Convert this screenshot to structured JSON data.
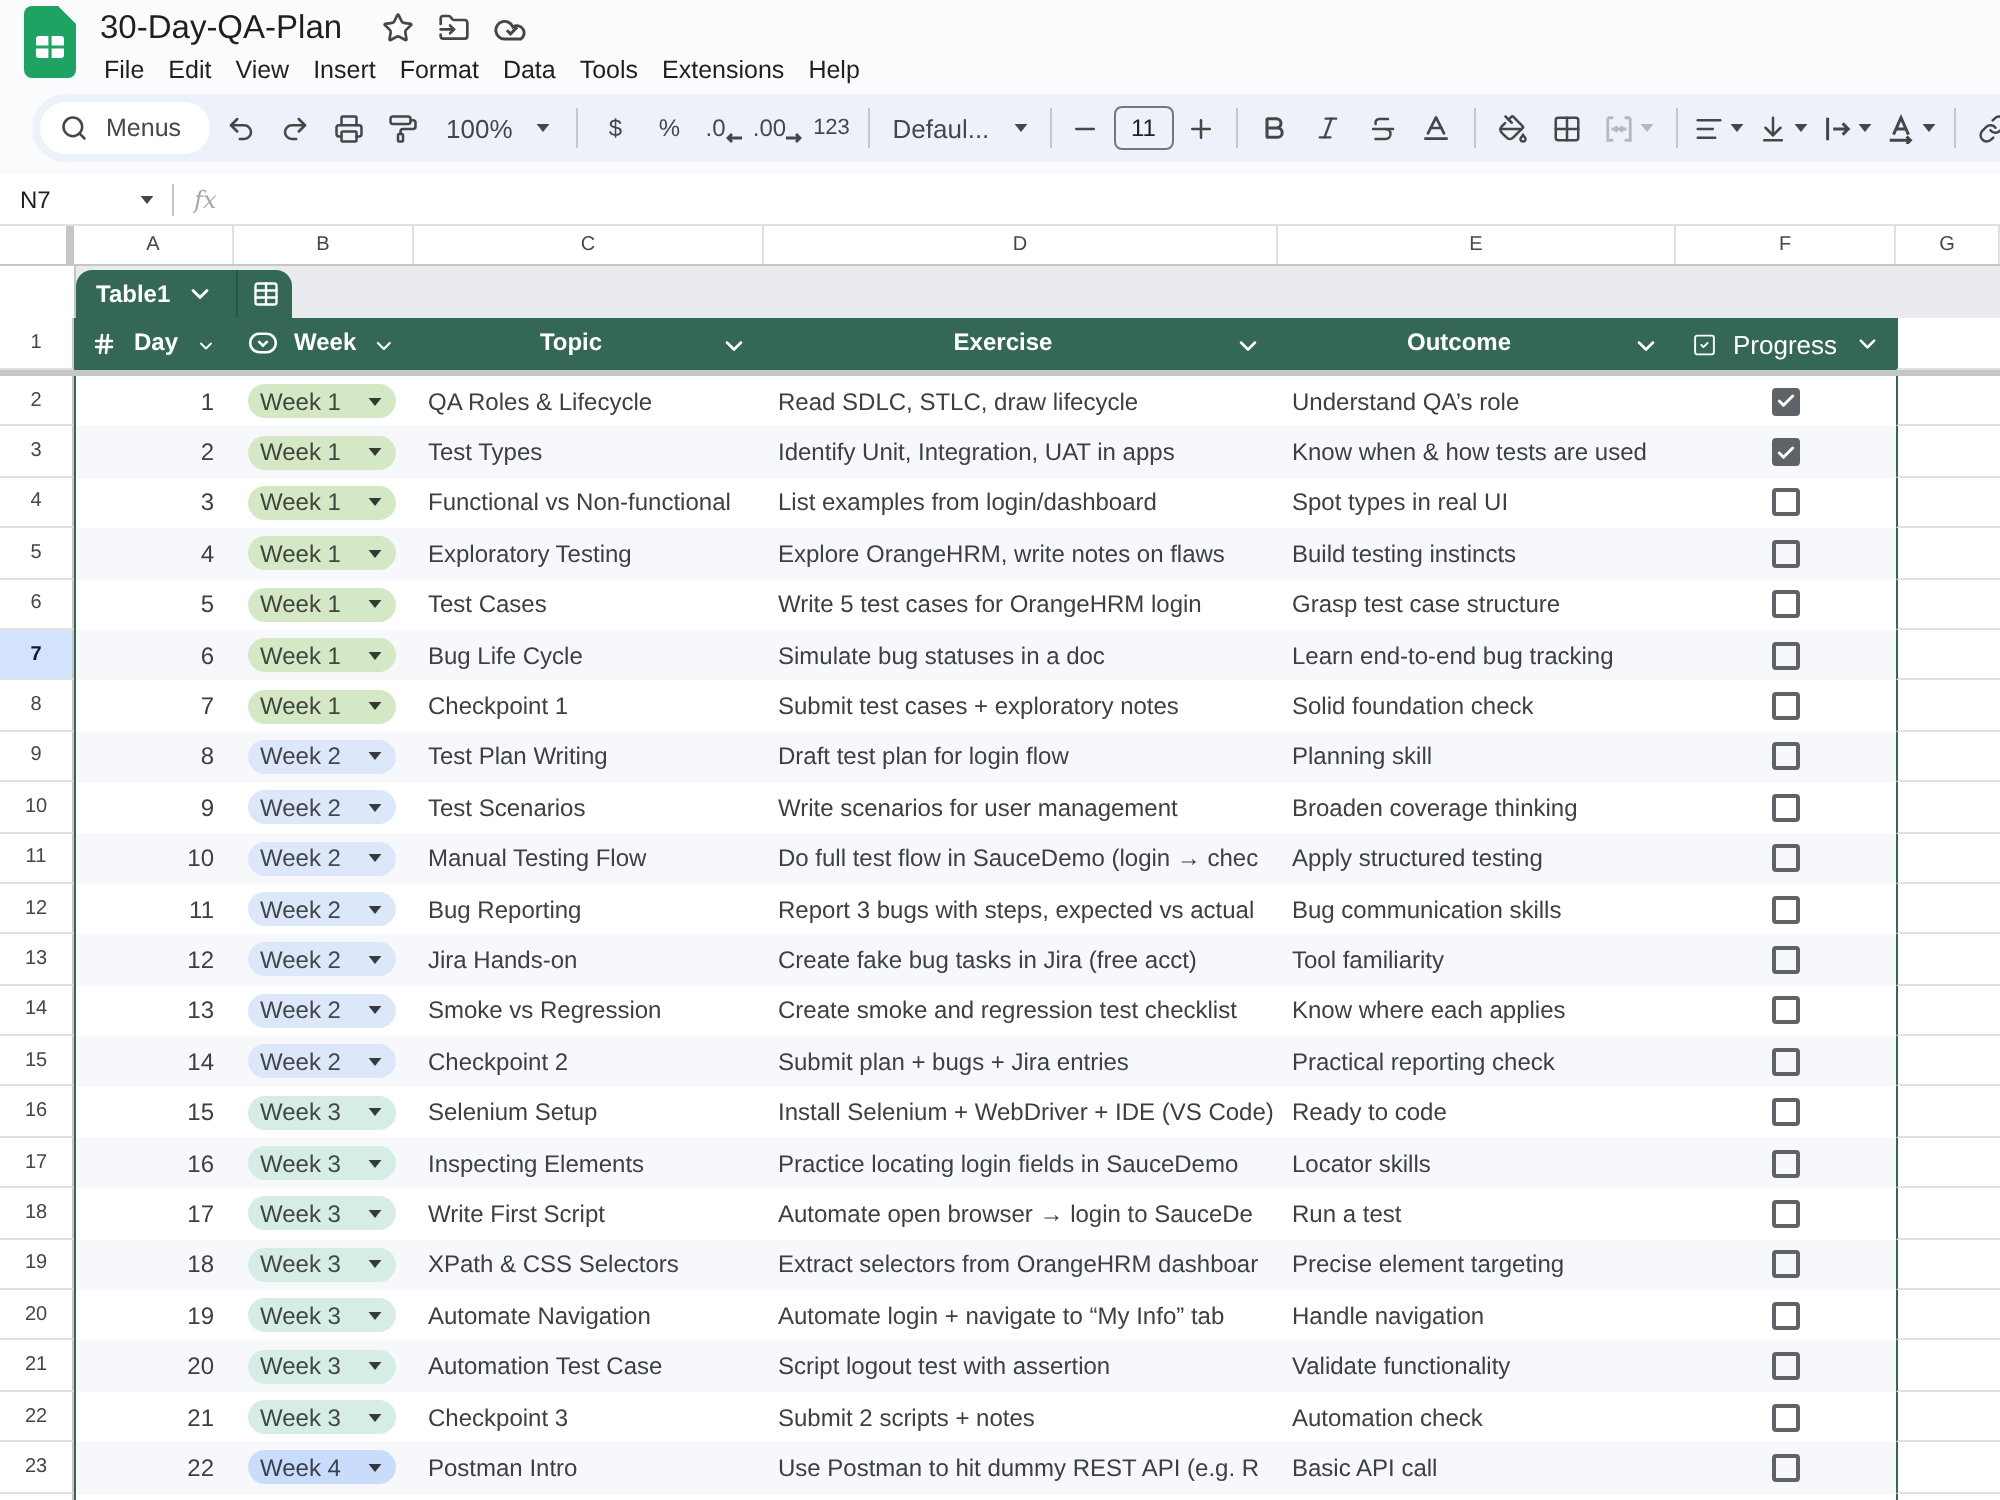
{
  "document": {
    "title": "30-Day-QA-Plan"
  },
  "menu": [
    "File",
    "Edit",
    "View",
    "Insert",
    "Format",
    "Data",
    "Tools",
    "Extensions",
    "Help"
  ],
  "toolbar": {
    "search": {
      "placeholder": "Menus"
    },
    "zoom": "100%",
    "number_formats": [
      {
        "label": "$",
        "kind": "plain"
      },
      {
        "label": "%",
        "kind": "plain"
      },
      {
        "label": ".0",
        "kind": "decrease"
      },
      {
        "label": ".00",
        "kind": "increase"
      },
      {
        "label": "123",
        "kind": "plain"
      }
    ],
    "font": "Defaul...",
    "font_size": "11"
  },
  "formula_bar": {
    "cell": "N7",
    "fx": "fx"
  },
  "columns": [
    "A",
    "B",
    "C",
    "D",
    "E",
    "F",
    "G"
  ],
  "row_numbers": [
    {
      "label": "1",
      "selected": false
    },
    {
      "label": "2",
      "selected": false
    },
    {
      "label": "3",
      "selected": false
    },
    {
      "label": "4",
      "selected": false
    },
    {
      "label": "5",
      "selected": false
    },
    {
      "label": "6",
      "selected": false
    },
    {
      "label": "7",
      "selected": true
    },
    {
      "label": "8",
      "selected": false
    },
    {
      "label": "9",
      "selected": false
    },
    {
      "label": "10",
      "selected": false
    },
    {
      "label": "11",
      "selected": false
    },
    {
      "label": "12",
      "selected": false
    },
    {
      "label": "13",
      "selected": false
    },
    {
      "label": "14",
      "selected": false
    },
    {
      "label": "15",
      "selected": false
    },
    {
      "label": "16",
      "selected": false
    },
    {
      "label": "17",
      "selected": false
    },
    {
      "label": "18",
      "selected": false
    },
    {
      "label": "19",
      "selected": false
    },
    {
      "label": "20",
      "selected": false
    },
    {
      "label": "21",
      "selected": false
    },
    {
      "label": "22",
      "selected": false
    },
    {
      "label": "23",
      "selected": false
    }
  ],
  "table": {
    "name": "Table1",
    "headers": [
      {
        "label": "Day",
        "kind": "number"
      },
      {
        "label": "Week",
        "kind": "dropdown"
      },
      {
        "label": "Topic",
        "kind": "text"
      },
      {
        "label": "Exercise",
        "kind": "text"
      },
      {
        "label": "Outcome",
        "kind": "text"
      },
      {
        "label": "Progress",
        "kind": "checkbox"
      }
    ],
    "rows": [
      {
        "day": "1",
        "week": {
          "label": "Week 1",
          "color": "#d4e8c6"
        },
        "topic": "QA Roles & Lifecycle",
        "exercise": "Read SDLC, STLC, draw lifecycle",
        "outcome": "Understand QA’s role",
        "checked": true
      },
      {
        "day": "2",
        "week": {
          "label": "Week 1",
          "color": "#d4e8c6"
        },
        "topic": "Test Types",
        "exercise": "Identify Unit, Integration, UAT in apps",
        "outcome": "Know when & how tests are used",
        "checked": true
      },
      {
        "day": "3",
        "week": {
          "label": "Week 1",
          "color": "#d4e8c6"
        },
        "topic": "Functional vs Non-functional",
        "exercise": "List examples from login/dashboard",
        "outcome": "Spot types in real UI",
        "checked": false
      },
      {
        "day": "4",
        "week": {
          "label": "Week 1",
          "color": "#d4e8c6"
        },
        "topic": "Exploratory Testing",
        "exercise": "Explore OrangeHRM, write notes on flaws",
        "outcome": "Build testing instincts",
        "checked": false
      },
      {
        "day": "5",
        "week": {
          "label": "Week 1",
          "color": "#d4e8c6"
        },
        "topic": "Test Cases",
        "exercise": "Write 5 test cases for OrangeHRM login",
        "outcome": "Grasp test case structure",
        "checked": false
      },
      {
        "day": "6",
        "week": {
          "label": "Week 1",
          "color": "#d4e8c6"
        },
        "topic": "Bug Life Cycle",
        "exercise": "Simulate bug statuses in a doc",
        "outcome": "Learn end-to-end bug tracking",
        "checked": false
      },
      {
        "day": "7",
        "week": {
          "label": "Week 1",
          "color": "#d4e8c6"
        },
        "topic": "Checkpoint 1",
        "exercise": "Submit test cases + exploratory notes",
        "outcome": "Solid foundation check",
        "checked": false
      },
      {
        "day": "8",
        "week": {
          "label": "Week 2",
          "color": "#dce8fa"
        },
        "topic": "Test Plan Writing",
        "exercise": "Draft test plan for login flow",
        "outcome": "Planning skill",
        "checked": false
      },
      {
        "day": "9",
        "week": {
          "label": "Week 2",
          "color": "#dce8fa"
        },
        "topic": "Test Scenarios",
        "exercise": "Write scenarios for user management",
        "outcome": "Broaden coverage thinking",
        "checked": false
      },
      {
        "day": "10",
        "week": {
          "label": "Week 2",
          "color": "#dce8fa"
        },
        "topic": "Manual Testing Flow",
        "exercise": "Do full test flow in SauceDemo (login → chec",
        "outcome": "Apply structured testing",
        "checked": false
      },
      {
        "day": "11",
        "week": {
          "label": "Week 2",
          "color": "#dce8fa"
        },
        "topic": "Bug Reporting",
        "exercise": "Report 3 bugs with steps, expected vs actual",
        "outcome": "Bug communication skills",
        "checked": false
      },
      {
        "day": "12",
        "week": {
          "label": "Week 2",
          "color": "#dce8fa"
        },
        "topic": "Jira Hands-on",
        "exercise": "Create fake bug tasks in Jira (free acct)",
        "outcome": "Tool familiarity",
        "checked": false
      },
      {
        "day": "13",
        "week": {
          "label": "Week 2",
          "color": "#dce8fa"
        },
        "topic": "Smoke vs Regression",
        "exercise": "Create smoke and regression test checklist",
        "outcome": "Know where each applies",
        "checked": false
      },
      {
        "day": "14",
        "week": {
          "label": "Week 2",
          "color": "#dce8fa"
        },
        "topic": "Checkpoint 2",
        "exercise": "Submit plan + bugs + Jira entries",
        "outcome": "Practical reporting check",
        "checked": false
      },
      {
        "day": "15",
        "week": {
          "label": "Week 3",
          "color": "#d5ede5"
        },
        "topic": "Selenium Setup",
        "exercise": "Install Selenium + WebDriver + IDE (VS Code)",
        "outcome": "Ready to code",
        "checked": false
      },
      {
        "day": "16",
        "week": {
          "label": "Week 3",
          "color": "#d5ede5"
        },
        "topic": "Inspecting Elements",
        "exercise": "Practice locating login fields in SauceDemo",
        "outcome": "Locator skills",
        "checked": false
      },
      {
        "day": "17",
        "week": {
          "label": "Week 3",
          "color": "#d5ede5"
        },
        "topic": "Write First Script",
        "exercise": "Automate open browser → login to SauceDe",
        "outcome": "Run a test",
        "checked": false
      },
      {
        "day": "18",
        "week": {
          "label": "Week 3",
          "color": "#d5ede5"
        },
        "topic": "XPath & CSS Selectors",
        "exercise": "Extract selectors from OrangeHRM dashboar",
        "outcome": "Precise element targeting",
        "checked": false
      },
      {
        "day": "19",
        "week": {
          "label": "Week 3",
          "color": "#d5ede5"
        },
        "topic": "Automate Navigation",
        "exercise": "Automate login + navigate to “My Info” tab",
        "outcome": "Handle navigation",
        "checked": false
      },
      {
        "day": "20",
        "week": {
          "label": "Week 3",
          "color": "#d5ede5"
        },
        "topic": "Automation Test Case",
        "exercise": "Script logout test with assertion",
        "outcome": "Validate functionality",
        "checked": false
      },
      {
        "day": "21",
        "week": {
          "label": "Week 3",
          "color": "#d5ede5"
        },
        "topic": "Checkpoint 3",
        "exercise": "Submit 2 scripts + notes",
        "outcome": "Automation check",
        "checked": false
      },
      {
        "day": "22",
        "week": {
          "label": "Week 4",
          "color": "#c9dcfb"
        },
        "topic": "Postman Intro",
        "exercise": "Use Postman to hit dummy REST API (e.g. R",
        "outcome": "Basic API call",
        "checked": false
      }
    ]
  }
}
